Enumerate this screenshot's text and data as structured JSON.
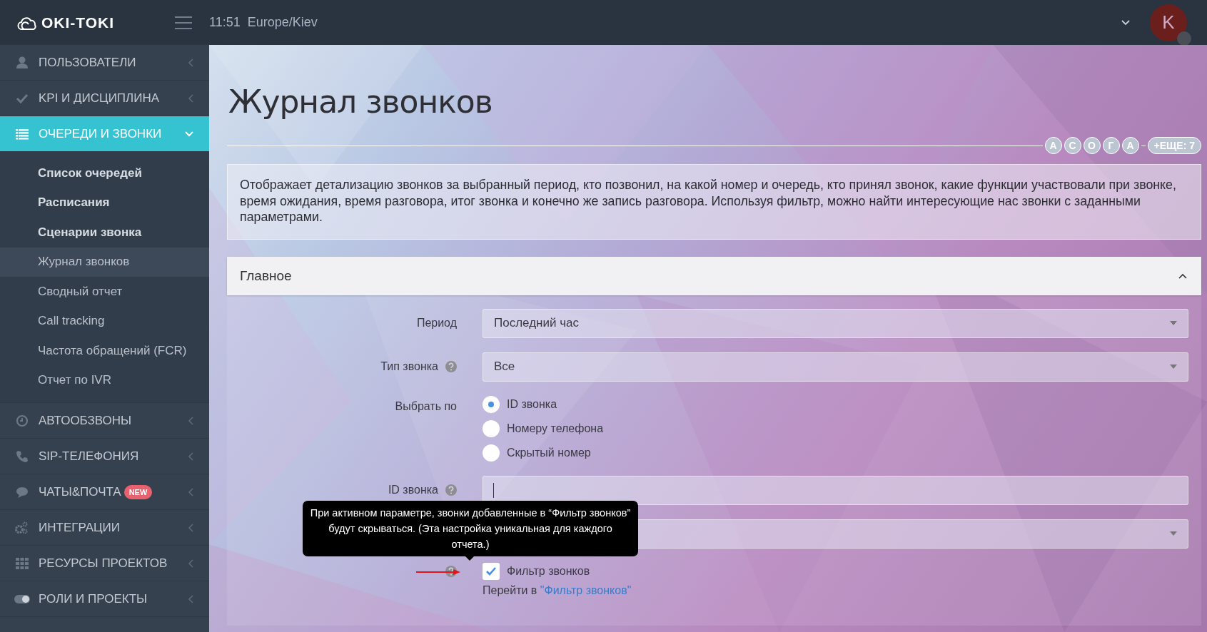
{
  "header": {
    "logo": "OKI-TOKI",
    "time": "11:51",
    "timezone": "Europe/Kiev",
    "avatar": "K"
  },
  "sidebar": {
    "items": [
      {
        "label": "ПОЛЬЗОВАТЕЛИ",
        "expanded": false,
        "selected": false
      },
      {
        "label": "KPI И ДИСЦИПЛИНА",
        "expanded": false,
        "selected": false
      },
      {
        "label": "ОЧЕРЕДИ И ЗВОНКИ",
        "expanded": true,
        "selected": true,
        "children": [
          {
            "label": "Список очередей",
            "kind": "heading",
            "selected": false
          },
          {
            "label": "Расписания",
            "kind": "heading",
            "selected": false
          },
          {
            "label": "Сценарии звонка",
            "kind": "heading",
            "selected": false
          },
          {
            "label": "Журнал звонков",
            "kind": "link",
            "selected": true
          },
          {
            "label": "Сводный отчет",
            "kind": "link",
            "selected": false
          },
          {
            "label": "Call tracking",
            "kind": "link",
            "selected": false
          },
          {
            "label": "Частота обращений (FCR)",
            "kind": "link",
            "selected": false
          },
          {
            "label": "Отчет по IVR",
            "kind": "link",
            "selected": false
          }
        ]
      },
      {
        "label": "АВТООБЗВОНЫ",
        "expanded": false,
        "selected": false
      },
      {
        "label": "SIP-ТЕЛЕФОНИЯ",
        "expanded": false,
        "selected": false
      },
      {
        "label": "ЧАТЫ&ПОЧТА",
        "badge": "NEW",
        "expanded": false,
        "selected": false
      },
      {
        "label": "ИНТЕГРАЦИИ",
        "expanded": false,
        "selected": false
      },
      {
        "label": "РЕСУРСЫ ПРОЕКТОВ",
        "expanded": false,
        "selected": false
      },
      {
        "label": "РОЛИ И ПРОЕКТЫ",
        "expanded": false,
        "selected": false
      }
    ]
  },
  "page": {
    "title": "Журнал звонков",
    "users": [
      "А",
      "С",
      "О",
      "Г",
      "А"
    ],
    "more": "+ЕЩЕ: 7",
    "description": "Отображает детализацию звонков за выбранный период, кто позвонил, на какой номер и очередь, кто принял звонок, какие функции участвовали при звонке, время ожидания, время разговора, итог звонка и конечно же запись разговора. Используя фильтр, можно найти интересующие нас звонки с заданными параметрами.",
    "panel": {
      "title": "Главное",
      "expanded": true,
      "fields": [
        {
          "kind": "select",
          "label": "Период",
          "value": "Последний час",
          "help": false
        },
        {
          "kind": "select",
          "label": "Тип звонка",
          "value": "Все",
          "help": true
        },
        {
          "kind": "radio",
          "label": "Выбрать по",
          "options": [
            {
              "label": "ID звонка",
              "selected": true
            },
            {
              "label": "Номеру телефона",
              "selected": false
            },
            {
              "label": "Скрытый номер",
              "selected": false
            }
          ]
        },
        {
          "kind": "input",
          "label": "ID звонка",
          "help": true
        },
        {
          "kind": "select",
          "help": false
        },
        {
          "kind": "checkbox",
          "text": "Фильтр звонков",
          "checked": true,
          "help": true
        },
        {
          "kind": "link",
          "text": "Перейти в",
          "link": "\"Фильтр звонков\""
        }
      ],
      "tooltip": "При активном параметре, звонки добавленные в “Фильтр звонков” будут скрываться. (Эта настройка уникальная для каждого отчета.)"
    }
  }
}
